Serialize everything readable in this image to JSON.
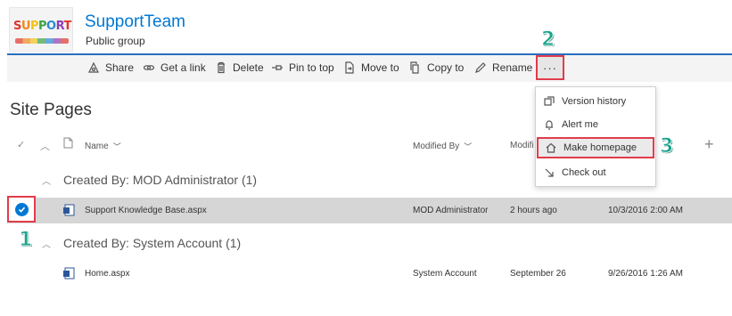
{
  "site": {
    "title": "SupportTeam",
    "subtitle": "Public group",
    "logo_letters": [
      "S",
      "U",
      "P",
      "P",
      "O",
      "R",
      "T"
    ]
  },
  "commands": {
    "share": "Share",
    "get_link": "Get a link",
    "delete": "Delete",
    "pin_to_top": "Pin to top",
    "move_to": "Move to",
    "copy_to": "Copy to",
    "rename": "Rename",
    "more": "···"
  },
  "menu": {
    "version_history": "Version history",
    "alert_me": "Alert me",
    "make_homepage": "Make homepage",
    "check_out": "Check out"
  },
  "library": {
    "title": "Site Pages",
    "columns": {
      "name": "Name",
      "modified_by": "Modified By",
      "modified": "Modifi"
    }
  },
  "groups": [
    {
      "header": "Created By: MOD Administrator (1)",
      "rows": [
        {
          "name": "Support Knowledge Base.aspx",
          "modified_by": "MOD Administrator",
          "modified": "2 hours ago",
          "created": "10/3/2016 2:00 AM",
          "selected": true
        }
      ]
    },
    {
      "header": "Created By: System Account (1)",
      "rows": [
        {
          "name": "Home.aspx",
          "modified_by": "System Account",
          "modified": "September 26",
          "created": "9/26/2016 1:26 AM",
          "selected": false
        }
      ]
    }
  ],
  "annotations": {
    "step1": "1",
    "step2": "2",
    "step3": "3"
  },
  "colors": {
    "accent": "#0078d4",
    "highlight": "#e23c4b",
    "step": "#19a38a"
  },
  "icons": [
    "share-icon",
    "link-icon",
    "trash-icon",
    "pin-icon",
    "move-icon",
    "copy-icon",
    "pencil-icon",
    "version-history-icon",
    "bell-icon",
    "home-icon",
    "checkout-icon",
    "aspx-file-icon",
    "check-icon"
  ]
}
